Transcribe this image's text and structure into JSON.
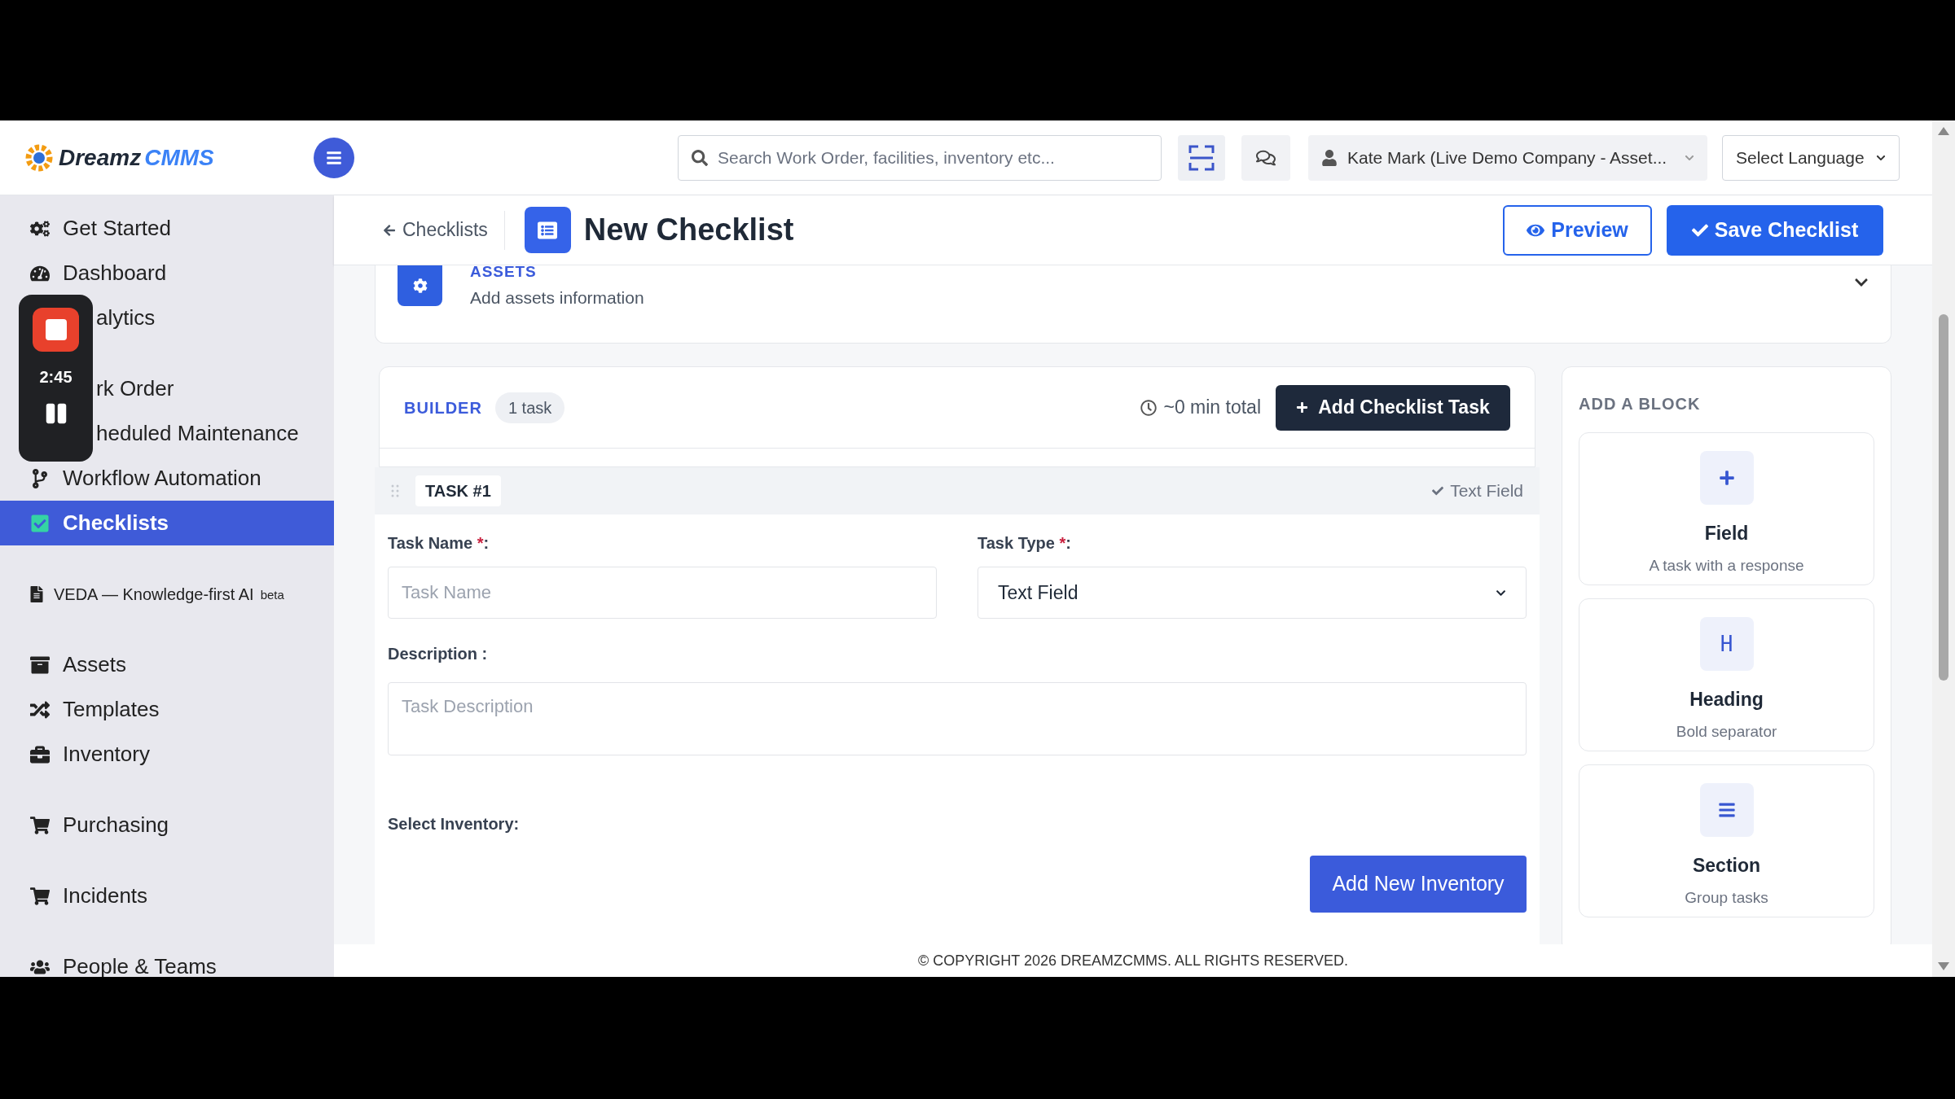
{
  "header": {
    "logo": {
      "part_1": "Dreamz",
      "part_2": "CMMS"
    },
    "search": {
      "placeholder": "Search Work Order, facilities, inventory etc..."
    },
    "user": "Kate Mark (Live Demo Company - Asset...",
    "language": "Select Language"
  },
  "sidebar": {
    "groups": [
      [
        {
          "label": "Get Started",
          "kind": "item",
          "selected": false
        },
        {
          "label": "Dashboard",
          "kind": "item",
          "selected": false
        },
        {
          "label": "alytics",
          "kind": "covered",
          "selected": false
        }
      ],
      [
        {
          "label": "rk Order",
          "kind": "covered",
          "selected": false
        },
        {
          "label": "heduled Maintenance",
          "kind": "covered",
          "selected": false
        },
        {
          "label": "Workflow Automation",
          "kind": "item",
          "selected": false
        },
        {
          "label": "Checklists",
          "kind": "item",
          "selected": true
        }
      ],
      [
        {
          "label": "VEDA — Knowledge-first AI",
          "badge": "beta",
          "kind": "small",
          "selected": false
        }
      ],
      [
        {
          "label": "Assets",
          "kind": "item",
          "selected": false
        },
        {
          "label": "Templates",
          "kind": "item",
          "selected": false
        },
        {
          "label": "Inventory",
          "kind": "item",
          "selected": false
        }
      ],
      [
        {
          "label": "Purchasing",
          "kind": "item",
          "selected": false
        }
      ],
      [
        {
          "label": "Incidents",
          "kind": "item",
          "selected": false
        }
      ],
      [
        {
          "label": "People & Teams",
          "kind": "item",
          "selected": false
        }
      ]
    ]
  },
  "recorder": {
    "time": "2:45"
  },
  "page": {
    "back": "Checklists",
    "title": "New Checklist",
    "preview": "Preview",
    "save": "Save Checklist"
  },
  "assets_card": {
    "title": "ASSETS",
    "subtitle": "Add assets information"
  },
  "builder": {
    "title": "BUILDER",
    "count": "1 task",
    "total": "~0 min total",
    "add_button": "Add Checklist Task",
    "task": {
      "number": "TASK #1",
      "type_badge": "Text Field",
      "name_label": "Task Name",
      "name_placeholder": "Task Name",
      "type_label": "Task Type",
      "type_value": "Text Field",
      "required_mark": "*",
      "label_colon": ":",
      "description_label": "Description :",
      "description_placeholder": "Task Description",
      "inventory_label": "Select Inventory:",
      "inventory_button": "Add New Inventory"
    }
  },
  "blocks": {
    "title": "ADD A BLOCK",
    "items": [
      {
        "kind": "field",
        "title": "Field",
        "subtitle": "A task with a response"
      },
      {
        "kind": "heading",
        "glyph": "H",
        "title": "Heading",
        "subtitle": "Bold separator"
      },
      {
        "kind": "section",
        "title": "Section",
        "subtitle": "Group tasks"
      }
    ]
  },
  "footer": "© COPYRIGHT 2026 DREAMZCMMS. ALL RIGHTS RESERVED."
}
